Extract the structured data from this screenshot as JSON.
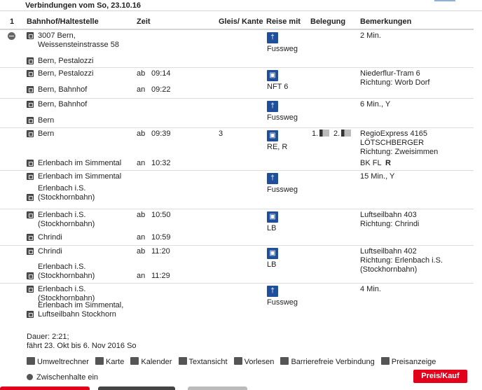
{
  "header_title": "Verbindungen vom So, 23.10.16",
  "columns": {
    "idx": "1",
    "station": "Bahnhof/Haltestelle",
    "time": "Zeit",
    "platform": "Gleis/ Kante",
    "travel": "Reise mit",
    "occupancy": "Belegung",
    "remarks": "Bemerkungen"
  },
  "legs": [
    {
      "from": "3007 Bern,\nWeissensteinstrasse 58",
      "to": "Bern, Pestalozzi",
      "mode": "Fussweg",
      "remark": "2 Min."
    },
    {
      "from": "Bern, Pestalozzi",
      "dep_prefix": "ab",
      "dep": "09:14",
      "to": "Bern, Bahnhof",
      "arr_prefix": "an",
      "arr": "09:22",
      "mode": "NFT 6",
      "remark": "Niederflur-Tram 6\nRichtung: Worb Dorf"
    },
    {
      "from": "Bern, Bahnhof",
      "to": "Bern",
      "mode": "Fussweg",
      "remark": "6 Min., Y"
    },
    {
      "from": "Bern",
      "dep_prefix": "ab",
      "dep": "09:39",
      "platform": "3",
      "to": "Erlenbach im Simmental",
      "arr_prefix": "an",
      "arr": "10:32",
      "mode": "RE, R",
      "occ1": "1.",
      "occ2": "2.",
      "remark": "RegioExpress 4165\nLÖTSCHBERGER\nRichtung: Zweisimmen",
      "remark2": "BK FL",
      "remark2b": "R"
    },
    {
      "from": "Erlenbach im Simmental",
      "to": "Erlenbach i.S.\n(Stockhornbahn)",
      "mode": "Fussweg",
      "remark": "15 Min., Y"
    },
    {
      "from": "Erlenbach i.S.\n(Stockhornbahn)",
      "dep_prefix": "ab",
      "dep": "10:50",
      "to": "Chrindi",
      "arr_prefix": "an",
      "arr": "10:59",
      "mode": "LB",
      "remark": "Luftseilbahn 403\nRichtung: Chrindi"
    },
    {
      "from": "Chrindi",
      "dep_prefix": "ab",
      "dep": "11:20",
      "to": "Erlenbach i.S.\n(Stockhornbahn)",
      "arr_prefix": "an",
      "arr": "11:29",
      "mode": "LB",
      "remark": "Luftseilbahn 402\nRichtung: Erlenbach i.S.\n(Stockhornbahn)"
    },
    {
      "from": "Erlenbach i.S.\n(Stockhornbahn)",
      "to": "Erlenbach im Simmental,\nLuftseilbahn Stockhorn",
      "mode": "Fussweg",
      "remark": "4 Min."
    }
  ],
  "duration": "Dauer: 2:21;",
  "runs": "fährt 23. Okt bis 6. Nov 2016 So",
  "tools": [
    "Umweltrechner",
    "Karte",
    "Kalender",
    "Textansicht",
    "Vorlesen",
    "Barrierefreie Verbindung",
    "Preisanzeige"
  ],
  "zwischenhalte": "Zwischenhalte ein",
  "price_button": "Preis/Kauf",
  "colors": {
    "accent": "#e3001b",
    "mode_icon": "#1f4f9a"
  }
}
